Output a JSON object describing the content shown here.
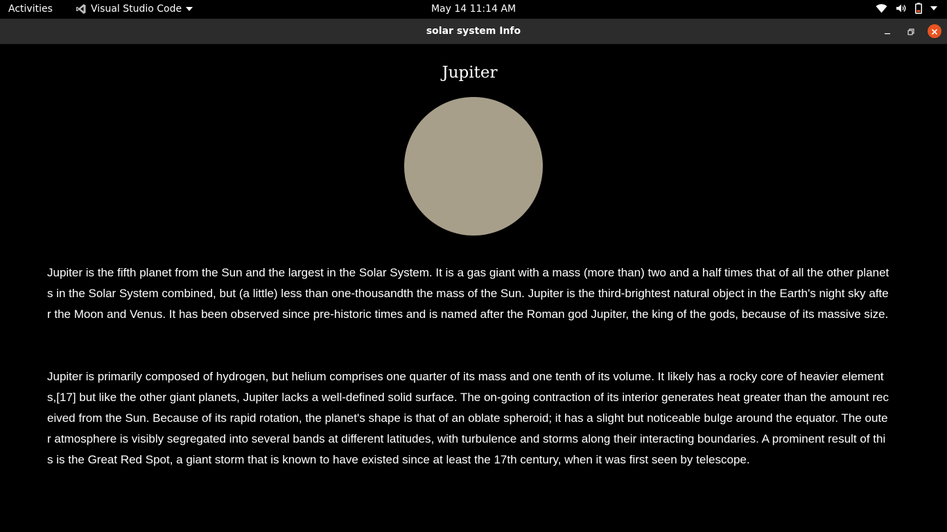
{
  "topbar": {
    "activities": "Activities",
    "app_name": "Visual Studio Code",
    "clock": "May 14  11:14 AM",
    "colors": {
      "battery": "#e95420"
    }
  },
  "window": {
    "title": "solar system Info",
    "close_color": "#e95420"
  },
  "planet": {
    "name": "Jupiter",
    "color": "#a79f8a",
    "paragraphs": [
      "Jupiter is the fifth planet from the Sun and the largest in the Solar System. It is a gas giant with a mass (more than) two and a half times that of all the other planets in the Solar System combined, but (a little) less than one-thousandth the mass of the Sun. Jupiter is the third-brightest natural object in the Earth's night sky after the Moon and Venus. It has been observed since pre-historic times and is named after the Roman god Jupiter, the king of the gods, because of its massive size.",
      "Jupiter is primarily composed of hydrogen, but helium comprises one quarter of its mass and one tenth of its volume. It likely has a rocky core of heavier elements,[17] but like the other giant planets, Jupiter lacks a well-defined solid surface. The on-going contraction of its interior generates heat greater than the amount received from the Sun. Because of its rapid rotation, the planet's shape is that of an oblate spheroid; it has a slight but noticeable bulge around the equator. The outer atmosphere is visibly segregated into several bands at different latitudes, with turbulence and storms along their interacting boundaries. A prominent result of this is the Great Red Spot, a giant storm that is known to have existed since at least the 17th century, when it was first seen by telescope."
    ]
  }
}
